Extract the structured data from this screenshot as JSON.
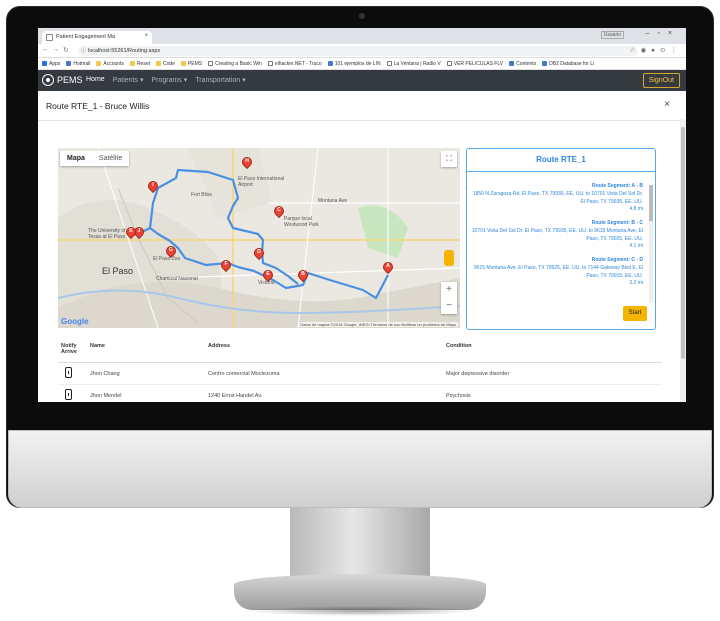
{
  "browser": {
    "tab_title": "Patient Engagement Ma",
    "profile": "Usuario",
    "url": "localhost:55261/Routing.aspx",
    "bookmarks": [
      "Apps",
      "Hotmail",
      "Accounts",
      "Reset",
      "Code",
      "PEMS",
      "Creating a Basic Win",
      "elhacker.NET - Truco",
      "101 ejemplos de LIN",
      "La Ventana | Radio V",
      "VER PELICULAS FLV",
      "Contents",
      "DB2 Database for Li"
    ]
  },
  "navbar": {
    "brand": "PEMS",
    "links": [
      "Home",
      "Patients",
      "Programs",
      "Transportation"
    ],
    "signout": "SignOut"
  },
  "modal": {
    "title": "Route RTE_1 - Bruce Willis",
    "close": "×"
  },
  "map": {
    "tabs": [
      "Mapa",
      "Satélite"
    ],
    "zoom_in": "+",
    "zoom_out": "−",
    "google_logo": "Google",
    "attribution": "Datos de mapas ©2018 Google, INEGI   Términos de uso   Notificar un problema de Maps",
    "labels": {
      "el_paso": "El Paso",
      "airport": "El Paso International Airport",
      "fort_bliss": "Fort Bliss",
      "utep": "The University of Texas at El Paso",
      "zoo": "El Paso Zoo",
      "park": "Parque local Westwood Park",
      "montana": "Montana Ave",
      "chamizal": "Chamizal Nacional",
      "victoria": "Victoria"
    },
    "pins": [
      "A",
      "B",
      "C",
      "D",
      "E",
      "F",
      "G",
      "H",
      "I",
      "J",
      "K"
    ]
  },
  "route_panel": {
    "title": "Route RTE_1",
    "segments": [
      {
        "title": "Route Segment: A - B",
        "from": "1850 N Zaragoza Rd, El Paso, TX 79936, EE. UU. to 10701 Vista Del Sol Dr, El Paso, TX 79935, EE. UU.",
        "distance": "4.8 mi"
      },
      {
        "title": "Route Segment: B - C",
        "from": "10701 Vista Del Sol Dr, El Paso, TX 79935, EE. UU. to 9615 Montana Ave, El Paso, TX 79925, EE. UU.",
        "distance": "4.1 mi"
      },
      {
        "title": "Route Segment: C - D",
        "from": "9615 Montana Ave, El Paso, TX 79925, EE. UU. to 7144 Gateway Blvd E, El Paso, TX 79915, EE. UU.",
        "distance": "3.2 mi"
      }
    ],
    "start_button": "Start"
  },
  "table": {
    "headers": [
      "Notify Arrive",
      "Name",
      "Address",
      "Condition"
    ],
    "rows": [
      {
        "name": "Jhon Chang",
        "address": "Centro comercial Moctezuma",
        "condition": "Major depressive disorder"
      },
      {
        "name": "Jhon Mendel",
        "address": "1240 Ernst Handel Av.",
        "condition": "Psychosis"
      }
    ]
  }
}
